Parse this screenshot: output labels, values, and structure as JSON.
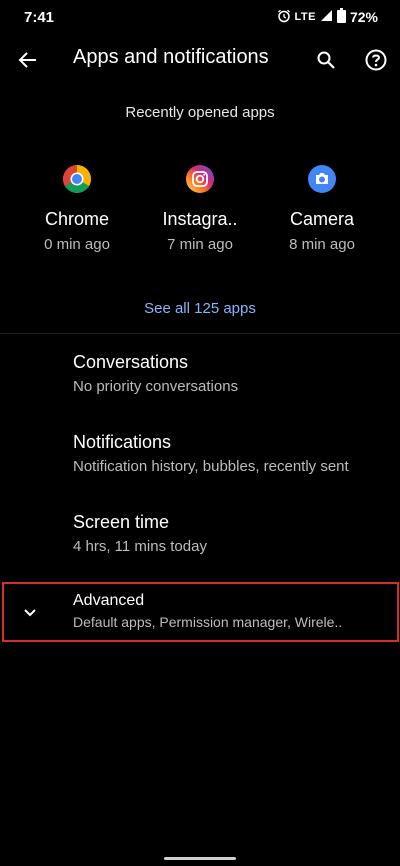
{
  "status_bar": {
    "time": "7:41",
    "network": "LTE",
    "battery": "72%"
  },
  "app_bar": {
    "title": "Apps and notifications"
  },
  "recent": {
    "heading": "Recently opened apps",
    "apps": [
      {
        "name": "Chrome",
        "time": "0 min ago",
        "icon": "chrome-icon"
      },
      {
        "name": "Instagra..",
        "time": "7 min ago",
        "icon": "instagram-icon"
      },
      {
        "name": "Camera",
        "time": "8 min ago",
        "icon": "camera-icon"
      }
    ],
    "see_all": "See all 125 apps"
  },
  "settings": [
    {
      "title": "Conversations",
      "summary": "No priority conversations"
    },
    {
      "title": "Notifications",
      "summary": "Notification history, bubbles, recently sent"
    },
    {
      "title": "Screen time",
      "summary": "4 hrs, 11 mins today"
    },
    {
      "title": "Advanced",
      "summary": "Default apps, Permission manager, Wirele.."
    }
  ],
  "colors": {
    "background": "#000000",
    "accent_link": "#8ab4f8",
    "highlight_border": "#d32f2f"
  }
}
